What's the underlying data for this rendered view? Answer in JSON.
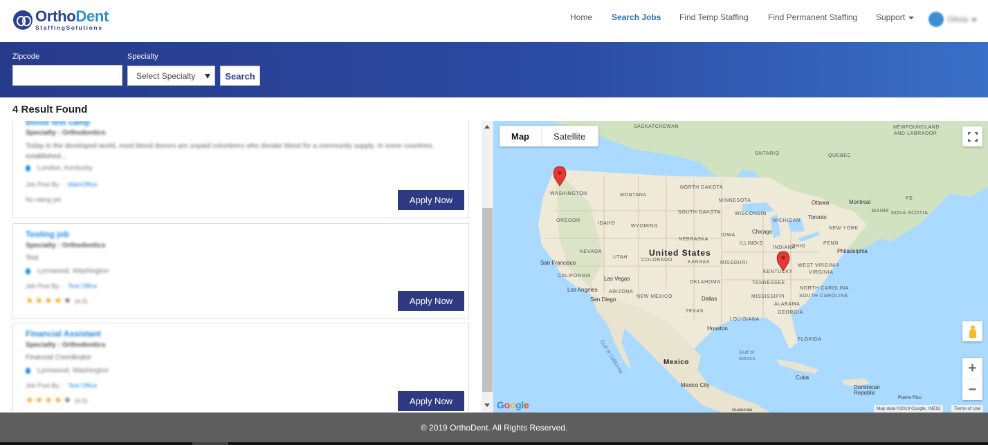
{
  "brand": {
    "name_part1": "Ortho",
    "name_part2": "Dent",
    "tagline": "StaffingSolutions"
  },
  "nav": {
    "home": "Home",
    "search_jobs": "Search Jobs",
    "find_temp": "Find Temp Staffing",
    "find_permanent": "Find Permanent Staffing",
    "support": "Support",
    "user_name": "Olivia"
  },
  "search": {
    "zipcode_label": "Zipcode",
    "zipcode_value": "",
    "specialty_label": "Specialty",
    "specialty_selected": "Select Specialty",
    "button": "Search"
  },
  "results": {
    "title": "4 Result Found"
  },
  "jobs": [
    {
      "title": "Blood test camp",
      "specialty": "Specialty : Orthodontics",
      "description": "Today in the developed world, most blood donors are unpaid volunteers who donate blood for a community supply. In some countries, established...",
      "location": "London, Kentucky",
      "posted_by_label": "Job Post By :",
      "posted_by": "MainOffice",
      "rating_text": "No rating yet",
      "apply": "Apply Now"
    },
    {
      "title": "Testing job",
      "specialty": "Specialty : Orthodontics",
      "description": "Test",
      "location": "Lynnwood, Washington",
      "posted_by_label": "Job Post By :",
      "posted_by": "Test Office",
      "rating": 4,
      "rating_max": 5,
      "rating_text": "(4.0)",
      "apply": "Apply Now"
    },
    {
      "title": "Financial Assistant",
      "specialty": "Specialty : Orthodontics",
      "description": "Financial Coordinator",
      "location": "Lynnwood, Washington",
      "posted_by_label": "Job Post By :",
      "posted_by": "Test Office",
      "rating": 4,
      "rating_max": 5,
      "rating_text": "(4.0)",
      "apply": "Apply Now"
    }
  ],
  "map": {
    "tab_map": "Map",
    "tab_satellite": "Satellite",
    "active_tab": "Map",
    "labels": {
      "saskatchewan": "SASKATCHEWAN",
      "newfoundland": "NEWFOUNDLAND",
      "labrador": "AND LABRADOR",
      "ontario": "ONTARIO",
      "quebec": "QUEBEC",
      "washington": "WASHINGTON",
      "montana": "MONTANA",
      "north_dakota": "NORTH DAKOTA",
      "minnesota": "MINNESOTA",
      "south_dakota": "SOUTH DAKOTA",
      "wisconsin": "WISCONSIN",
      "michigan": "MICHIGAN",
      "oregon": "OREGON",
      "idaho": "IDAHO",
      "wyoming": "WYOMING",
      "nebraska": "NEBRASKA",
      "iowa": "IOWA",
      "illinois": "ILLINOIS",
      "nevada": "NEVADA",
      "utah": "UTAH",
      "colorado": "COLORADO",
      "kansas": "KANSAS",
      "missouri": "MISSOURI",
      "california": "CALIFORNIA",
      "arizona": "ARIZONA",
      "new_mexico": "NEW MEXICO",
      "oklahoma": "OKLAHOMA",
      "texas": "TEXAS",
      "louisiana": "LOUISIANA",
      "mississippi": "MISSISSIPPI",
      "alabama": "ALABAMA",
      "tennessee": "TENNESSEE",
      "kentucky": "KENTUCKY",
      "virginia": "VIRGINIA",
      "west_virginia": "WEST VIRGINIA",
      "north_carolina": "NORTH CAROLINA",
      "south_carolina": "SOUTH CAROLINA",
      "georgia": "GEORGIA",
      "florida": "FLORIDA",
      "indiana": "INDIANA",
      "ohio": "OHIO",
      "penn": "PENN",
      "new_york": "NEW YORK",
      "maine": "MAINE",
      "nova_scotia": "NOVA SCOTIA",
      "pei": "PE",
      "united_states": "United States",
      "mexico": "Mexico",
      "cuba": "Cuba",
      "dominican": "Dominican Republic",
      "puerto_rico": "Puerto Rico",
      "gulf_of_mexico": "Gulf of Mexico",
      "gulf_of_california": "Gulf of California",
      "ottawa": "Ottawa",
      "montreal": "Montreal",
      "toronto": "Toronto",
      "chicago": "Chicago",
      "philadelphia": "Philadelphia",
      "san_francisco": "San Francisco",
      "las_vegas": "Las Vegas",
      "los_angeles": "Los Angeles",
      "san_diego": "San Diego",
      "dallas": "Dallas",
      "houston": "Houston",
      "mexico_city": "Mexico City",
      "guatemala": "Guatemala"
    },
    "google": "Google",
    "attribution": "Map data ©2019 Google, INEGI",
    "terms": "Terms of Use"
  },
  "footer": {
    "copyright": "© 2019 OrthoDent. All Rights Reserved."
  },
  "colors": {
    "primary": "#2e3b82",
    "link": "#1e88e5",
    "active_nav": "#2a6fb3",
    "footer": "#5e5e5e",
    "marker": "#e53935",
    "star": "#f5a623"
  }
}
